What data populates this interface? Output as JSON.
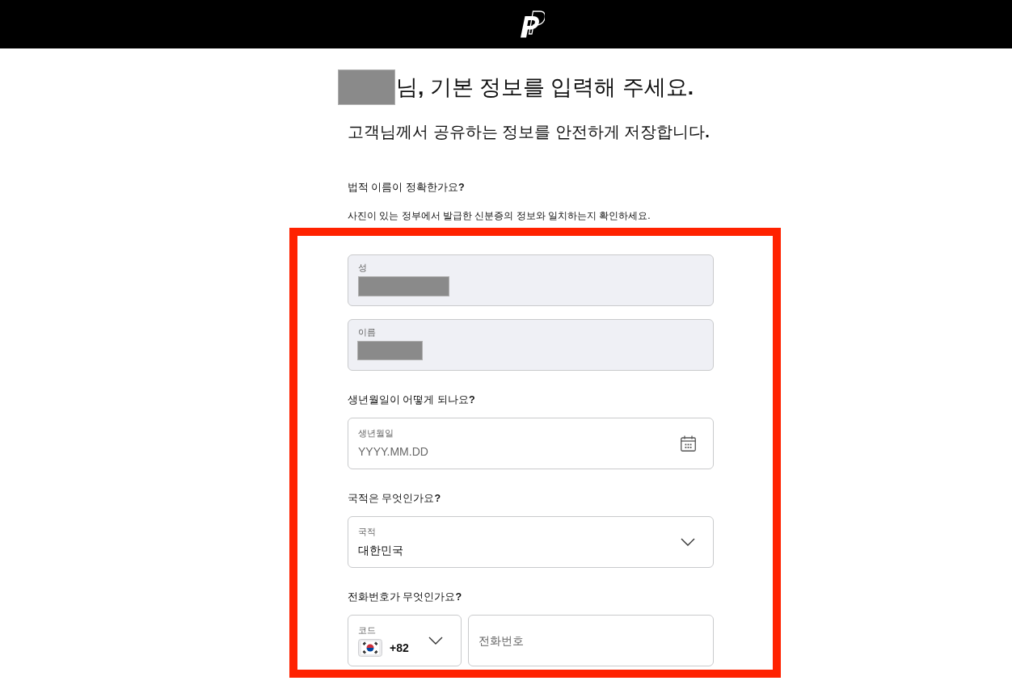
{
  "greeting": {
    "name_redacted": true,
    "text": "님**,** 기본 정보를 입력해 주세요**.**"
  },
  "subtitle": "고객님께서 공유하는 정보를 안전하게 저장합니다**.**",
  "name_intro": {
    "question": "법적 이름이 정확한가요**?**",
    "note": "사진이 있는 정부에서 발급한 신분증의 정보와 일치하는지 확인하세요."
  },
  "highlight": {
    "groups": [
      {
        "fields": [
          {
            "kind": "text",
            "label": "성",
            "value_redacted": true,
            "disabled": true
          },
          {
            "kind": "text",
            "label": "이름",
            "value_redacted": true,
            "disabled": true
          }
        ]
      },
      {
        "question": "생년월일이 어떻게 되나요**?**",
        "fields": [
          {
            "kind": "date",
            "label": "생년월일",
            "placeholder": "YYYY.MM.DD",
            "disabled": false
          }
        ]
      },
      {
        "question": "국적은 무엇인가요**?**",
        "fields": [
          {
            "kind": "select",
            "label": "국적",
            "value": "대한민국",
            "disabled": false
          }
        ]
      },
      {
        "question": "전화번호가 무엇인가요**?**",
        "fields": [
          {
            "kind": "code_select",
            "label": "코드",
            "value": "+82",
            "disabled": false
          },
          {
            "kind": "phone",
            "placeholder": "전화번호",
            "disabled": false
          }
        ]
      }
    ]
  }
}
